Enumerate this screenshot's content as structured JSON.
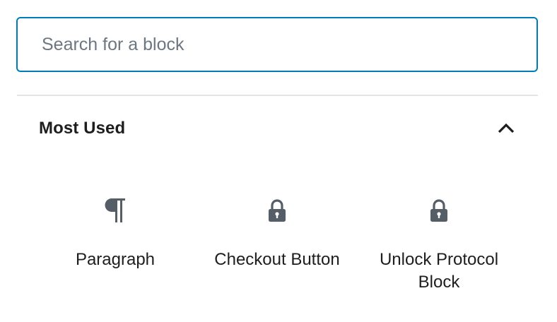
{
  "search": {
    "placeholder": "Search for a block",
    "value": ""
  },
  "panel": {
    "title": "Most Used",
    "expanded": true,
    "toggle_icon": "chevron-up-icon"
  },
  "blocks": [
    {
      "label": "Paragraph",
      "icon": "paragraph-icon"
    },
    {
      "label": "Checkout Button",
      "icon": "lock-icon"
    },
    {
      "label": "Unlock Protocol Block",
      "icon": "lock-icon"
    }
  ],
  "colors": {
    "accent": "#007cba",
    "text": "#1e1e1e",
    "icon": "#555d66",
    "placeholder": "#6c7781",
    "divider": "#e2e4e7"
  }
}
